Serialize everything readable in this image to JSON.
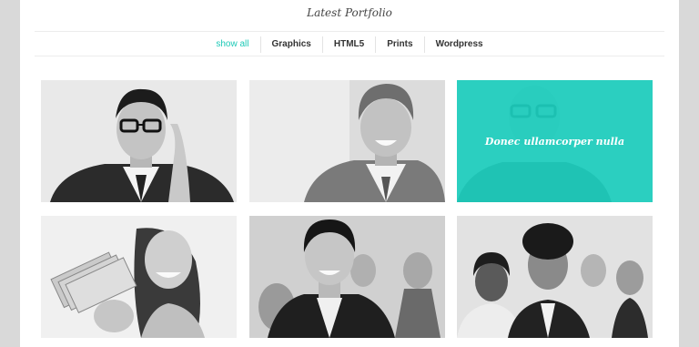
{
  "portfolio": {
    "title": "Latest Portfolio",
    "filters": [
      {
        "label": "show all",
        "active": true
      },
      {
        "label": "Graphics",
        "active": false
      },
      {
        "label": "HTML5",
        "active": false
      },
      {
        "label": "Prints",
        "active": false
      },
      {
        "label": "Wordpress",
        "active": false
      }
    ],
    "hover_caption": "Donec ullamcorper nulla",
    "accent_color": "#1dc9b7"
  }
}
